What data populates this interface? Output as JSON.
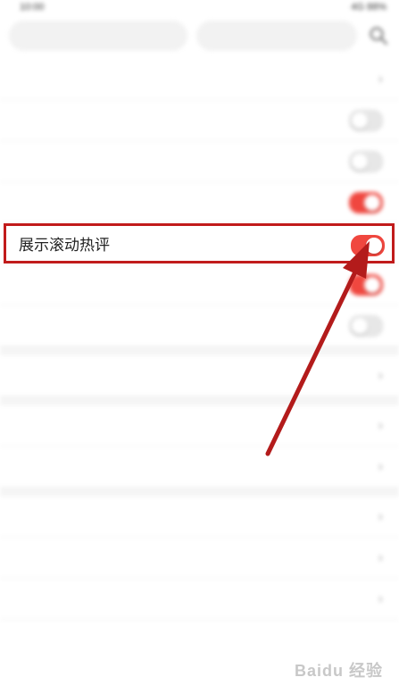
{
  "status_bar": {
    "time": "10:00",
    "right": "4G 88%"
  },
  "top_tabs": [
    "",
    ""
  ],
  "settings_rows": [
    {
      "label": "",
      "control": "value",
      "value": ""
    },
    {
      "label": "",
      "control": "toggle-off"
    },
    {
      "label": "",
      "control": "toggle-off",
      "value": "",
      "value_color": "#e53935"
    },
    {
      "label": "",
      "control": "toggle-on"
    }
  ],
  "highlighted_row": {
    "label": "展示滚动热评",
    "toggle_on": true
  },
  "settings_rows_after": [
    {
      "label": "",
      "control": "toggle-on"
    },
    {
      "label": "",
      "control": "toggle-off"
    }
  ],
  "group2_rows": [
    {
      "label": "",
      "value": ""
    }
  ],
  "group3_rows": [
    {
      "label": "",
      "value": ""
    },
    {
      "label": "",
      "value": ""
    }
  ],
  "group4_rows": [
    {
      "label": ""
    },
    {
      "label": ""
    },
    {
      "label": ""
    }
  ],
  "logout_label": "",
  "colors": {
    "accent_red": "#f0473f",
    "highlight_border": "#c11b1b",
    "arrow_red": "#b31b1b"
  },
  "watermark": "Baidu 经验"
}
